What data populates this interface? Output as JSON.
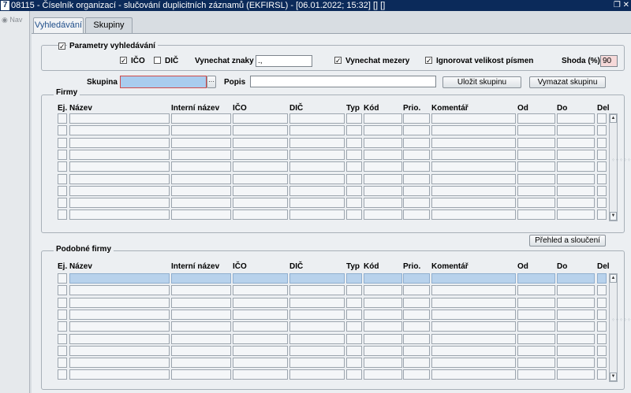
{
  "window": {
    "app_icon": "7",
    "title": "08115 - Číselník organizací - slučování duplicitních záznamů (EKFIRSL) - [06.01.2022; 15:32] [] []",
    "controls": "❐ ✕"
  },
  "leftpane": {
    "nav_label": "Nav"
  },
  "tabs": [
    {
      "label": "Vyhledávání"
    },
    {
      "label": "Skupiny"
    }
  ],
  "search_params": {
    "group_label": "Parametry vyhledávání",
    "enabled": true,
    "ico": {
      "label": "IČO",
      "checked": true
    },
    "dic": {
      "label": "DIČ",
      "checked": false
    },
    "skip_chars": {
      "label": "Vynechat znaky",
      "value": ".,"
    },
    "skip_spaces": {
      "label": "Vynechat mezery",
      "checked": true
    },
    "ignore_case": {
      "label": "Ignorovat velikost písmen",
      "checked": true
    },
    "match": {
      "label": "Shoda (%)",
      "value": "90"
    }
  },
  "group_bar": {
    "skupina_label": "Skupina",
    "skupina_value": "",
    "lookup_button": "···",
    "popis_label": "Popis",
    "popis_value": "",
    "save_button": "Uložit skupinu",
    "delete_button": "Vymazat skupinu"
  },
  "firmy": {
    "title": "Firmy",
    "columns": [
      "Ej.",
      "Název",
      "Interní název",
      "IČO",
      "DIČ",
      "Typ",
      "Kód",
      "Prio.",
      "Komentář",
      "Od",
      "Do",
      "Del"
    ]
  },
  "overview_button": "Přehled a sloučení",
  "podobne": {
    "title": "Podobné firmy",
    "columns": [
      "Ej.",
      "Název",
      "Interní název",
      "IČO",
      "DIČ",
      "Typ",
      "Kód",
      "Prio.",
      "Komentář",
      "Od",
      "Do",
      "Del"
    ]
  },
  "colors": {
    "titlebar": "#0b2a5a",
    "selected_row": "#b8d2ec",
    "shoda_bg": "#f6d9d9",
    "skupina_bg": "#a9ccee"
  }
}
